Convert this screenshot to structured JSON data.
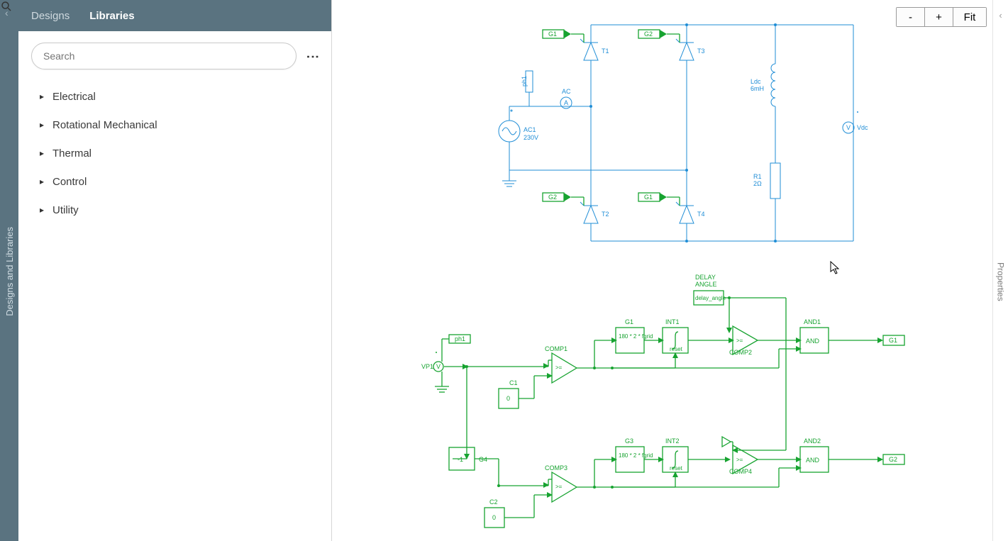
{
  "sidebar": {
    "title": "Designs and Libraries",
    "tabs": {
      "designs": "Designs",
      "libraries": "Libraries"
    },
    "search_placeholder": "Search",
    "tree": [
      "Electrical",
      "Rotational Mechanical",
      "Thermal",
      "Control",
      "Utility"
    ]
  },
  "zoom": {
    "minus": "-",
    "plus": "+",
    "fit": "Fit"
  },
  "rightbar": {
    "label": "Properties"
  },
  "schematic": {
    "ac_source": {
      "name": "AC1",
      "value": "230V"
    },
    "ammeter": "AC",
    "probe": "ph1",
    "thyristors": {
      "t1": "T1",
      "t2": "T2",
      "t3": "T3",
      "t4": "T4"
    },
    "gates": {
      "g1": "G1",
      "g2": "G2"
    },
    "inductor": {
      "name": "Ldc",
      "value": "6mH"
    },
    "resistor": {
      "name": "R1",
      "value": "2Ω"
    },
    "voltmeter": "Vdc"
  },
  "control": {
    "vp": "VP1",
    "probe": "ph1",
    "comp": {
      "c1": "COMP1",
      "c2": "COMP2",
      "c3": "COMP3",
      "c4": "COMP4"
    },
    "const": {
      "c1": "C1",
      "c1v": "0",
      "c2": "C2",
      "c2v": "0",
      "g4": "G4",
      "g4v": "-1"
    },
    "gain": {
      "g1": "G1",
      "g1v": "180 * 2 * fgrid",
      "g3": "G3",
      "g3v": "180 * 2 * fgrid"
    },
    "int": {
      "i1": "INT1",
      "i1r": "reset",
      "i2": "INT2",
      "i2r": "reset"
    },
    "delay": {
      "title1": "DELAY",
      "title2": "ANGLE",
      "val": "delay_angle"
    },
    "and": {
      "a1": "AND1",
      "a1v": "AND",
      "a2": "AND2",
      "a2v": "AND"
    },
    "out": {
      "g1": "G1",
      "g2": "G2"
    }
  }
}
